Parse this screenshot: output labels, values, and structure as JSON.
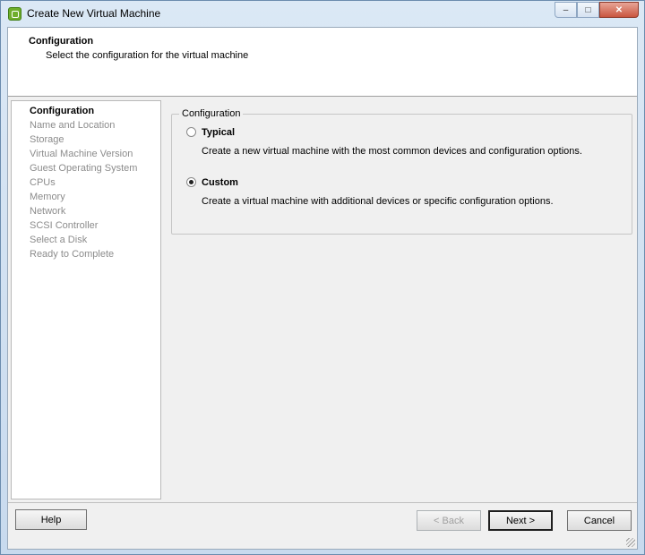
{
  "window": {
    "title": "Create New Virtual Machine"
  },
  "header": {
    "title": "Configuration",
    "subtitle": "Select the configuration for the virtual machine"
  },
  "nav": {
    "items": [
      "Configuration",
      "Name and Location",
      "Storage",
      "Virtual Machine Version",
      "Guest Operating System",
      "CPUs",
      "Memory",
      "Network",
      "SCSI Controller",
      "Select a Disk",
      "Ready to Complete"
    ],
    "active": "Configuration"
  },
  "config": {
    "group_title": "Configuration",
    "typical": {
      "label": "Typical",
      "description": "Create a new virtual machine with the most common devices and configuration options."
    },
    "custom": {
      "label": "Custom",
      "description": "Create a virtual machine with additional devices or specific configuration options."
    },
    "selected": "Custom"
  },
  "buttons": {
    "help": "Help",
    "back": "< Back",
    "next": "Next >",
    "cancel": "Cancel"
  },
  "icons": {
    "app": "vsphere-app-icon",
    "minimize": "minimize-icon",
    "maximize": "maximize-icon",
    "close": "close-icon",
    "grip": "resize-grip-icon"
  }
}
